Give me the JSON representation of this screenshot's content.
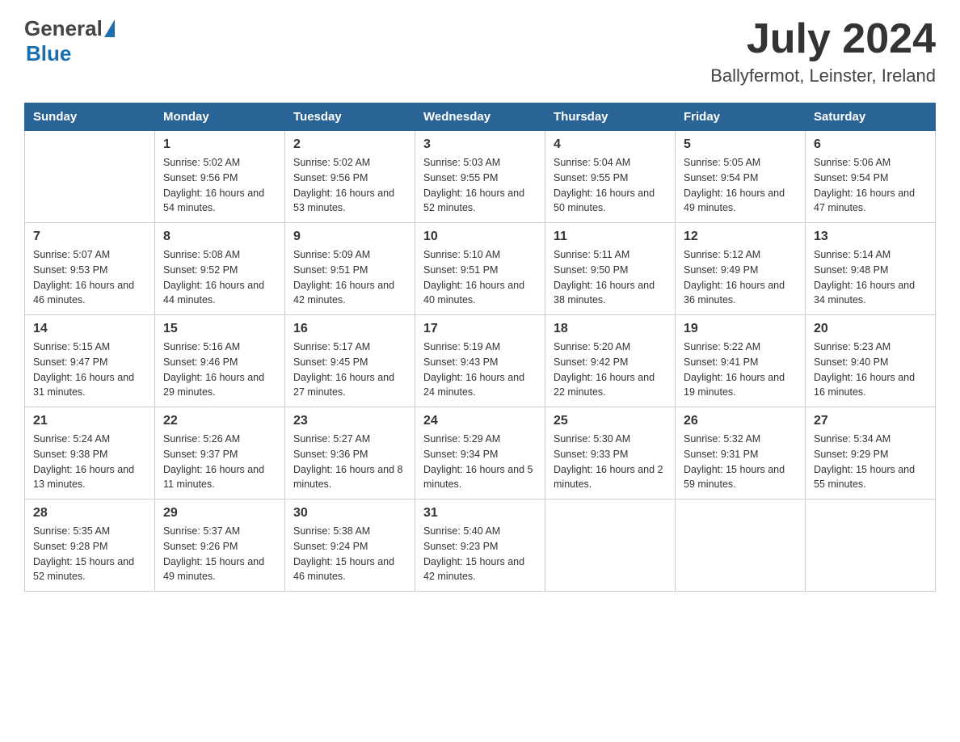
{
  "header": {
    "logo_general": "General",
    "logo_blue": "Blue",
    "month": "July 2024",
    "location": "Ballyfermot, Leinster, Ireland"
  },
  "days_of_week": [
    "Sunday",
    "Monday",
    "Tuesday",
    "Wednesday",
    "Thursday",
    "Friday",
    "Saturday"
  ],
  "weeks": [
    [
      {
        "day": "",
        "sunrise": "",
        "sunset": "",
        "daylight": ""
      },
      {
        "day": "1",
        "sunrise": "Sunrise: 5:02 AM",
        "sunset": "Sunset: 9:56 PM",
        "daylight": "Daylight: 16 hours and 54 minutes."
      },
      {
        "day": "2",
        "sunrise": "Sunrise: 5:02 AM",
        "sunset": "Sunset: 9:56 PM",
        "daylight": "Daylight: 16 hours and 53 minutes."
      },
      {
        "day": "3",
        "sunrise": "Sunrise: 5:03 AM",
        "sunset": "Sunset: 9:55 PM",
        "daylight": "Daylight: 16 hours and 52 minutes."
      },
      {
        "day": "4",
        "sunrise": "Sunrise: 5:04 AM",
        "sunset": "Sunset: 9:55 PM",
        "daylight": "Daylight: 16 hours and 50 minutes."
      },
      {
        "day": "5",
        "sunrise": "Sunrise: 5:05 AM",
        "sunset": "Sunset: 9:54 PM",
        "daylight": "Daylight: 16 hours and 49 minutes."
      },
      {
        "day": "6",
        "sunrise": "Sunrise: 5:06 AM",
        "sunset": "Sunset: 9:54 PM",
        "daylight": "Daylight: 16 hours and 47 minutes."
      }
    ],
    [
      {
        "day": "7",
        "sunrise": "Sunrise: 5:07 AM",
        "sunset": "Sunset: 9:53 PM",
        "daylight": "Daylight: 16 hours and 46 minutes."
      },
      {
        "day": "8",
        "sunrise": "Sunrise: 5:08 AM",
        "sunset": "Sunset: 9:52 PM",
        "daylight": "Daylight: 16 hours and 44 minutes."
      },
      {
        "day": "9",
        "sunrise": "Sunrise: 5:09 AM",
        "sunset": "Sunset: 9:51 PM",
        "daylight": "Daylight: 16 hours and 42 minutes."
      },
      {
        "day": "10",
        "sunrise": "Sunrise: 5:10 AM",
        "sunset": "Sunset: 9:51 PM",
        "daylight": "Daylight: 16 hours and 40 minutes."
      },
      {
        "day": "11",
        "sunrise": "Sunrise: 5:11 AM",
        "sunset": "Sunset: 9:50 PM",
        "daylight": "Daylight: 16 hours and 38 minutes."
      },
      {
        "day": "12",
        "sunrise": "Sunrise: 5:12 AM",
        "sunset": "Sunset: 9:49 PM",
        "daylight": "Daylight: 16 hours and 36 minutes."
      },
      {
        "day": "13",
        "sunrise": "Sunrise: 5:14 AM",
        "sunset": "Sunset: 9:48 PM",
        "daylight": "Daylight: 16 hours and 34 minutes."
      }
    ],
    [
      {
        "day": "14",
        "sunrise": "Sunrise: 5:15 AM",
        "sunset": "Sunset: 9:47 PM",
        "daylight": "Daylight: 16 hours and 31 minutes."
      },
      {
        "day": "15",
        "sunrise": "Sunrise: 5:16 AM",
        "sunset": "Sunset: 9:46 PM",
        "daylight": "Daylight: 16 hours and 29 minutes."
      },
      {
        "day": "16",
        "sunrise": "Sunrise: 5:17 AM",
        "sunset": "Sunset: 9:45 PM",
        "daylight": "Daylight: 16 hours and 27 minutes."
      },
      {
        "day": "17",
        "sunrise": "Sunrise: 5:19 AM",
        "sunset": "Sunset: 9:43 PM",
        "daylight": "Daylight: 16 hours and 24 minutes."
      },
      {
        "day": "18",
        "sunrise": "Sunrise: 5:20 AM",
        "sunset": "Sunset: 9:42 PM",
        "daylight": "Daylight: 16 hours and 22 minutes."
      },
      {
        "day": "19",
        "sunrise": "Sunrise: 5:22 AM",
        "sunset": "Sunset: 9:41 PM",
        "daylight": "Daylight: 16 hours and 19 minutes."
      },
      {
        "day": "20",
        "sunrise": "Sunrise: 5:23 AM",
        "sunset": "Sunset: 9:40 PM",
        "daylight": "Daylight: 16 hours and 16 minutes."
      }
    ],
    [
      {
        "day": "21",
        "sunrise": "Sunrise: 5:24 AM",
        "sunset": "Sunset: 9:38 PM",
        "daylight": "Daylight: 16 hours and 13 minutes."
      },
      {
        "day": "22",
        "sunrise": "Sunrise: 5:26 AM",
        "sunset": "Sunset: 9:37 PM",
        "daylight": "Daylight: 16 hours and 11 minutes."
      },
      {
        "day": "23",
        "sunrise": "Sunrise: 5:27 AM",
        "sunset": "Sunset: 9:36 PM",
        "daylight": "Daylight: 16 hours and 8 minutes."
      },
      {
        "day": "24",
        "sunrise": "Sunrise: 5:29 AM",
        "sunset": "Sunset: 9:34 PM",
        "daylight": "Daylight: 16 hours and 5 minutes."
      },
      {
        "day": "25",
        "sunrise": "Sunrise: 5:30 AM",
        "sunset": "Sunset: 9:33 PM",
        "daylight": "Daylight: 16 hours and 2 minutes."
      },
      {
        "day": "26",
        "sunrise": "Sunrise: 5:32 AM",
        "sunset": "Sunset: 9:31 PM",
        "daylight": "Daylight: 15 hours and 59 minutes."
      },
      {
        "day": "27",
        "sunrise": "Sunrise: 5:34 AM",
        "sunset": "Sunset: 9:29 PM",
        "daylight": "Daylight: 15 hours and 55 minutes."
      }
    ],
    [
      {
        "day": "28",
        "sunrise": "Sunrise: 5:35 AM",
        "sunset": "Sunset: 9:28 PM",
        "daylight": "Daylight: 15 hours and 52 minutes."
      },
      {
        "day": "29",
        "sunrise": "Sunrise: 5:37 AM",
        "sunset": "Sunset: 9:26 PM",
        "daylight": "Daylight: 15 hours and 49 minutes."
      },
      {
        "day": "30",
        "sunrise": "Sunrise: 5:38 AM",
        "sunset": "Sunset: 9:24 PM",
        "daylight": "Daylight: 15 hours and 46 minutes."
      },
      {
        "day": "31",
        "sunrise": "Sunrise: 5:40 AM",
        "sunset": "Sunset: 9:23 PM",
        "daylight": "Daylight: 15 hours and 42 minutes."
      },
      {
        "day": "",
        "sunrise": "",
        "sunset": "",
        "daylight": ""
      },
      {
        "day": "",
        "sunrise": "",
        "sunset": "",
        "daylight": ""
      },
      {
        "day": "",
        "sunrise": "",
        "sunset": "",
        "daylight": ""
      }
    ]
  ]
}
